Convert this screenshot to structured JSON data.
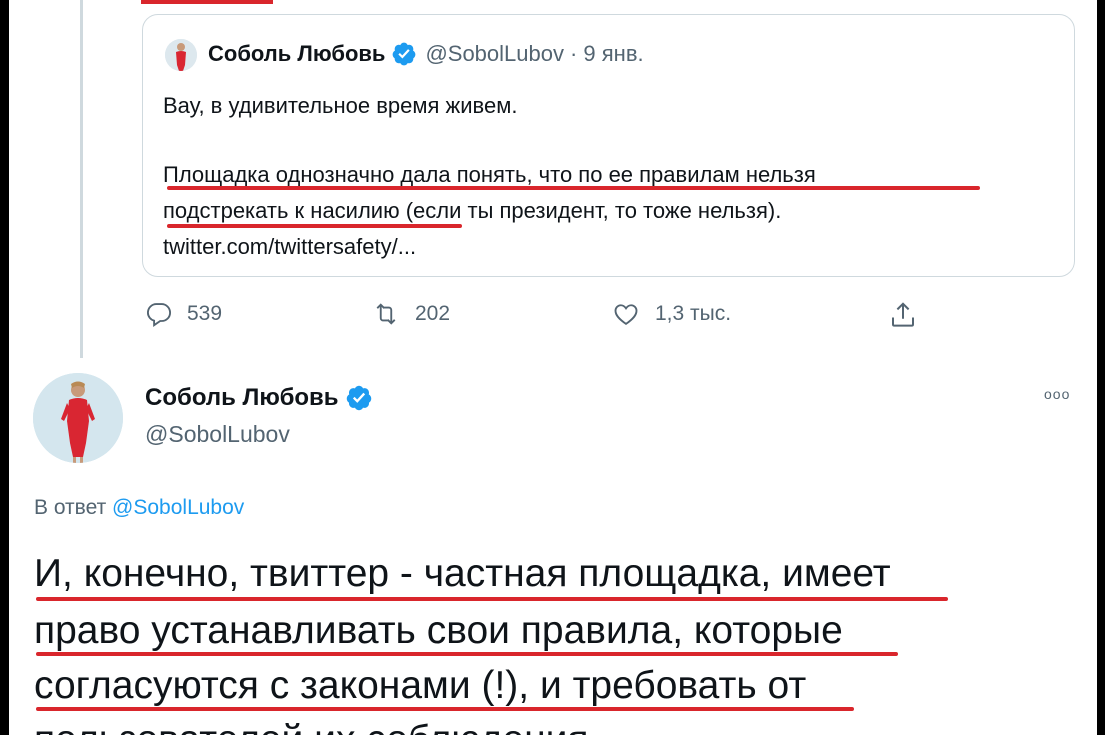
{
  "quoted_tweet": {
    "author_name": "Соболь Любовь",
    "author_handle": "@SobolLubov",
    "date": "· 9 янв.",
    "line1": "Вау, в удивительное время живем.",
    "line2": "Площадка однозначно дала понять, что по ее правилам нельзя",
    "line3": "подстрекать к насилию (если ты президент, то тоже нельзя).",
    "link": "twitter.com/twittersafety/..."
  },
  "actions": {
    "replies": "539",
    "retweets": "202",
    "likes": "1,3 тыс."
  },
  "main_tweet": {
    "author_name": "Соболь Любовь",
    "author_handle": "@SobolLubov",
    "more": "ооо",
    "reply_prefix": "В ответ",
    "reply_handle": "@SobolLubov",
    "line1": "И, конечно, твиттер - частная площадка, имеет",
    "line2": "право устанавливать свои правила, которые",
    "line3": "согласуются с законами (!), и требовать от",
    "line4": "пользователей их соблюдения."
  },
  "colors": {
    "highlight_red": "#d9262c",
    "verified_blue": "#1d9bf0",
    "muted_text": "#536471"
  },
  "icons": [
    "reply-icon",
    "retweet-icon",
    "like-icon",
    "share-icon",
    "verified-badge-icon",
    "more-icon"
  ]
}
